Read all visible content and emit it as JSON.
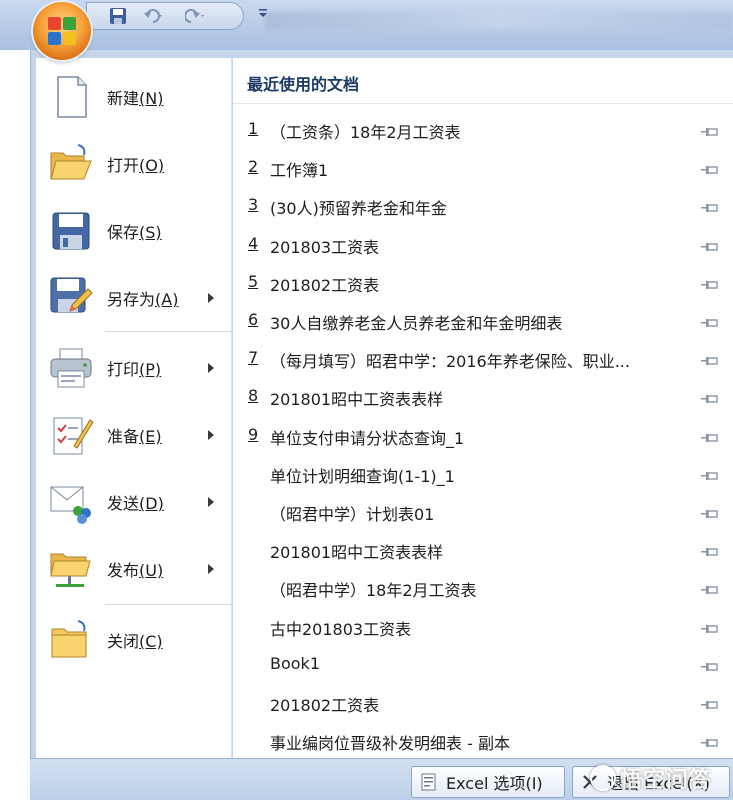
{
  "commands": [
    {
      "label": "新建",
      "key": "(N)",
      "icon": "new-document-icon",
      "submenu": false
    },
    {
      "label": "打开",
      "key": "(O)",
      "icon": "open-folder-icon",
      "submenu": false
    },
    {
      "label": "保存",
      "key": "(S)",
      "icon": "save-disk-icon",
      "submenu": false
    },
    {
      "label": "另存为",
      "key": "(A)",
      "icon": "save-as-icon",
      "submenu": true
    },
    {
      "label": "打印",
      "key": "(P)",
      "icon": "printer-icon",
      "submenu": true
    },
    {
      "label": "准备",
      "key": "(E)",
      "icon": "prepare-document-icon",
      "submenu": true
    },
    {
      "label": "发送",
      "key": "(D)",
      "icon": "send-icon",
      "submenu": true
    },
    {
      "label": "发布",
      "key": "(U)",
      "icon": "publish-icon",
      "submenu": true
    },
    {
      "label": "关闭",
      "key": "(C)",
      "icon": "close-folder-icon",
      "submenu": false
    }
  ],
  "recent": {
    "header": "最近使用的文档",
    "items": [
      {
        "num": "1",
        "name": "（工资条）18年2月工资表"
      },
      {
        "num": "2",
        "name": "工作簿1"
      },
      {
        "num": "3",
        "name": "(30人)预留养老金和年金"
      },
      {
        "num": "4",
        "name": "201803工资表"
      },
      {
        "num": "5",
        "name": "201802工资表"
      },
      {
        "num": "6",
        "name": "30人自缴养老金人员养老金和年金明细表"
      },
      {
        "num": "7",
        "name": "（每月填写）昭君中学：2016年养老保险、职业..."
      },
      {
        "num": "8",
        "name": "201801昭中工资表表样"
      },
      {
        "num": "9",
        "name": "单位支付申请分状态查询_1"
      },
      {
        "num": "",
        "name": "单位计划明细查询(1-1)_1"
      },
      {
        "num": "",
        "name": "（昭君中学）计划表01"
      },
      {
        "num": "",
        "name": "201801昭中工资表表样"
      },
      {
        "num": "",
        "name": "（昭君中学）18年2月工资表"
      },
      {
        "num": "",
        "name": "古中201803工资表"
      },
      {
        "num": "",
        "name": "Book1"
      },
      {
        "num": "",
        "name": "201802工资表"
      },
      {
        "num": "",
        "name": "事业编岗位晋级补发明细表 - 副本"
      }
    ]
  },
  "bottom": {
    "options_label": "Excel 选项(I)",
    "exit_label": "退出 Excel(X)"
  },
  "watermark": "悟空问答",
  "colors": {
    "frame": "#c5d5ea",
    "header_text": "#1b3a66",
    "office_orange": "#f7a23a"
  }
}
